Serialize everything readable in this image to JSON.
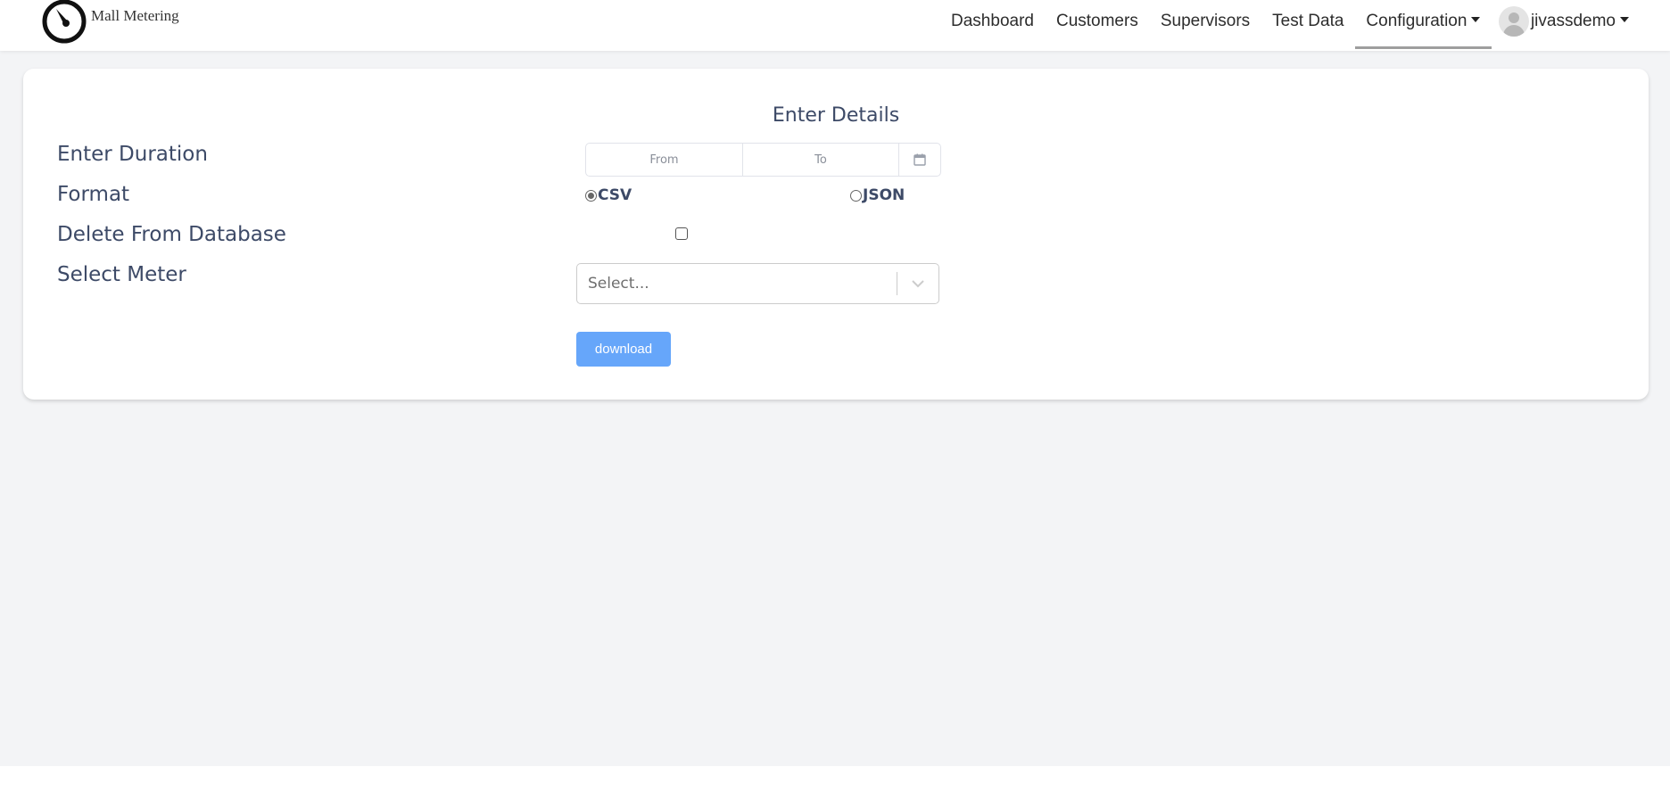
{
  "header": {
    "logo_text": "Mall Metering",
    "nav": [
      {
        "label": "Dashboard"
      },
      {
        "label": "Customers"
      },
      {
        "label": "Supervisors"
      },
      {
        "label": "Test Data"
      },
      {
        "label": "Configuration",
        "active": true,
        "dropdown": true
      }
    ],
    "user": {
      "name": "jivassdemo",
      "icon": "avatar-icon"
    }
  },
  "form": {
    "title": "Enter Details",
    "labels": {
      "duration": "Enter Duration",
      "format": "Format",
      "delete": "Delete From Database",
      "meter": "Select Meter"
    },
    "date_from_placeholder": "From",
    "date_to_placeholder": "To",
    "formats": [
      {
        "label": "CSV",
        "selected": true
      },
      {
        "label": "JSON",
        "selected": false
      }
    ],
    "delete_checked": false,
    "meter_placeholder": "Select...",
    "download_label": "download",
    "accent_color": "#66a6fa"
  }
}
